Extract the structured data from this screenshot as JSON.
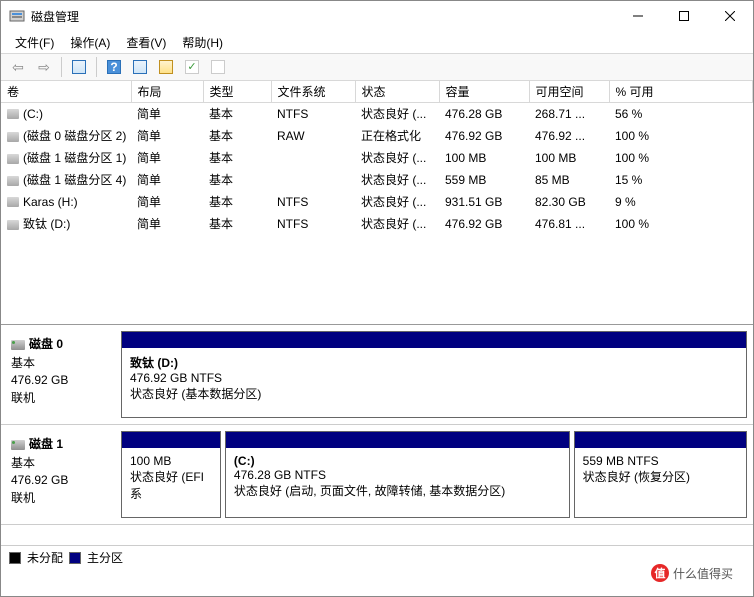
{
  "window": {
    "title": "磁盘管理"
  },
  "menu": {
    "file": "文件(F)",
    "action": "操作(A)",
    "view": "查看(V)",
    "help": "帮助(H)"
  },
  "columns": {
    "volume": "卷",
    "layout": "布局",
    "type": "类型",
    "filesystem": "文件系统",
    "status": "状态",
    "capacity": "容量",
    "free": "可用空间",
    "percent": "% 可用"
  },
  "volumes": [
    {
      "name": "(C:)",
      "layout": "简单",
      "type": "基本",
      "fs": "NTFS",
      "status": "状态良好 (...",
      "cap": "476.28 GB",
      "free": "268.71 ...",
      "pct": "56 %"
    },
    {
      "name": "(磁盘 0 磁盘分区 2)",
      "layout": "简单",
      "type": "基本",
      "fs": "RAW",
      "status": "正在格式化",
      "cap": "476.92 GB",
      "free": "476.92 ...",
      "pct": "100 %"
    },
    {
      "name": "(磁盘 1 磁盘分区 1)",
      "layout": "简单",
      "type": "基本",
      "fs": "",
      "status": "状态良好 (...",
      "cap": "100 MB",
      "free": "100 MB",
      "pct": "100 %"
    },
    {
      "name": "(磁盘 1 磁盘分区 4)",
      "layout": "简单",
      "type": "基本",
      "fs": "",
      "status": "状态良好 (...",
      "cap": "559 MB",
      "free": "85 MB",
      "pct": "15 %"
    },
    {
      "name": "Karas (H:)",
      "layout": "简单",
      "type": "基本",
      "fs": "NTFS",
      "status": "状态良好 (...",
      "cap": "931.51 GB",
      "free": "82.30 GB",
      "pct": "9 %"
    },
    {
      "name": "致钛 (D:)",
      "layout": "简单",
      "type": "基本",
      "fs": "NTFS",
      "status": "状态良好 (...",
      "cap": "476.92 GB",
      "free": "476.81 ...",
      "pct": "100 %"
    }
  ],
  "disks": [
    {
      "name": "磁盘 0",
      "type": "基本",
      "size": "476.92 GB",
      "status": "联机",
      "parts": [
        {
          "title": "致钛  (D:)",
          "line2": "476.92 GB NTFS",
          "line3": "状态良好 (基本数据分区)",
          "flex": 1
        }
      ]
    },
    {
      "name": "磁盘 1",
      "type": "基本",
      "size": "476.92 GB",
      "status": "联机",
      "parts": [
        {
          "title": "",
          "line2": "100 MB",
          "line3": "状态良好 (EFI 系",
          "flex": 0.16
        },
        {
          "title": "(C:)",
          "line2": "476.28 GB NTFS",
          "line3": "状态良好 (启动, 页面文件, 故障转储, 基本数据分区)",
          "flex": 0.56
        },
        {
          "title": "",
          "line2": "559 MB NTFS",
          "line3": "状态良好 (恢复分区)",
          "flex": 0.28
        }
      ]
    }
  ],
  "legend": {
    "unallocated": "未分配",
    "primary": "主分区"
  },
  "watermark": "什么值得买"
}
